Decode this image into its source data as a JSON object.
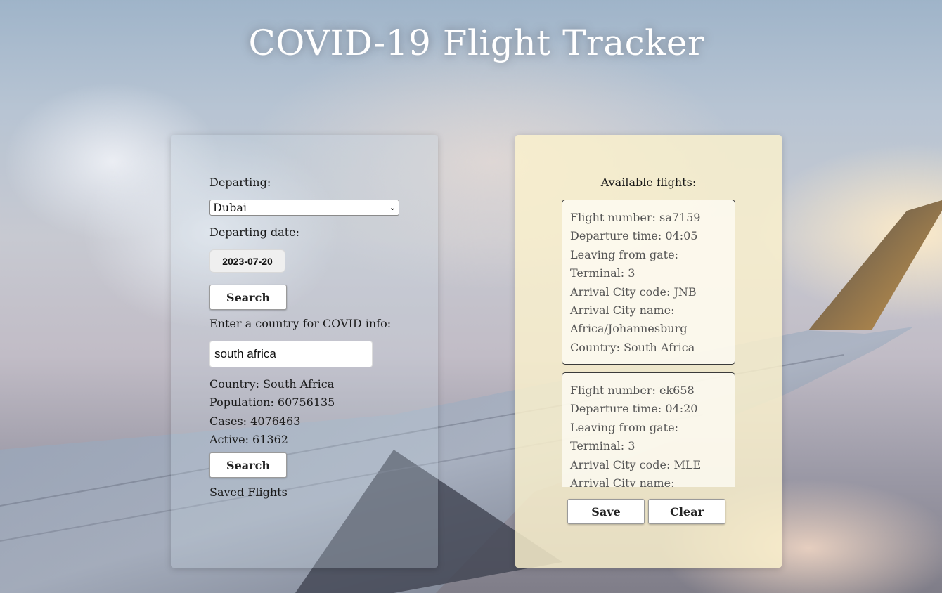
{
  "header": {
    "title": "COVID-19 Flight Tracker"
  },
  "search_panel": {
    "departing_label": "Departing:",
    "departing_value": "Dubai",
    "departing_date_label": "Departing date:",
    "departing_date_value": "2023-07-20",
    "search_button_label": "Search",
    "country_prompt": "Enter a country for COVID info:",
    "country_input_value": "south africa",
    "covid_info": {
      "country": "Country: South Africa",
      "population": "Population: 60756135",
      "cases": "Cases: 4076463",
      "active": "Active: 61362"
    },
    "search_button_2_label": "Search",
    "saved_flights_label": "Saved Flights"
  },
  "flights_panel": {
    "title": "Available flights:",
    "flights": [
      {
        "flight_number": "Flight number: sa7159",
        "departure_time": "Departure time: 04:05",
        "gate": "Leaving from gate:",
        "terminal": "Terminal: 3",
        "arrival_code": "Arrival City code: JNB",
        "arrival_name_label": "Arrival City name:",
        "arrival_name": "Africa/Johannesburg",
        "country": "Country:  South Africa"
      },
      {
        "flight_number": "Flight number: ek658",
        "departure_time": "Departure time: 04:20",
        "gate": "Leaving from gate:",
        "terminal": "Terminal: 3",
        "arrival_code": "Arrival City code: MLE",
        "arrival_name_label": "Arrival City name:"
      }
    ],
    "save_button_label": "Save",
    "clear_button_label": "Clear"
  },
  "icons": {
    "select_arrow": "chevron-down-icon"
  }
}
